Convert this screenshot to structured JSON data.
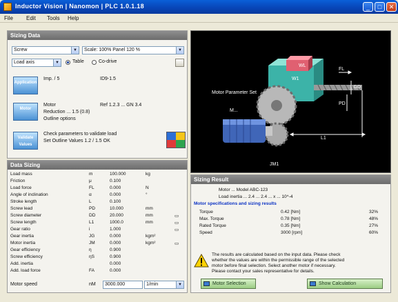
{
  "window": {
    "title": "Inductor Vision | Nanomon            | PLC 1.0.1.18",
    "minimize": "_",
    "maximize": "□",
    "close": "✕"
  },
  "menu": [
    "File",
    "Edit",
    "Tools",
    "Help"
  ],
  "sizing_data": {
    "header": "Sizing Data",
    "combo_1": "Screw",
    "combo_2": "Scale: 100% Panel 120 %",
    "combo_3": "Load axis",
    "radio_1": "Table",
    "radio_2": "Co-drive",
    "rows": [
      {
        "button": "Application",
        "text_a": "Imp. / 5",
        "text_b": "ID9-1.5"
      },
      {
        "button": "Motor",
        "text_a": "Motor",
        "text_b": "Ref 1.2.3 ... GN 3.4",
        "text_c": "Reduction ... 1.5 (0.8)",
        "text_d": "Outline options"
      },
      {
        "button": "Validate Values",
        "text_a": "Check parameters to validate load",
        "text_b": "Set Outline Values 1.2 / 1.5 OK"
      }
    ]
  },
  "diagram": {
    "labels": {
      "wl": "WL",
      "w1": "W1",
      "fl": "FL",
      "dd": "DD",
      "pd": "PD",
      "motor": "Motor Parameter Set",
      "m": "M...",
      "l": "L1",
      "j": "JM1"
    }
  },
  "data_sizing": {
    "header": "Data Sizing",
    "rows": [
      {
        "label": "Load mass",
        "sym": "m",
        "val": "100.000",
        "unit": "kg",
        "unit2": ""
      },
      {
        "label": "Friction",
        "sym": "μ",
        "val": "0.100",
        "unit": "",
        "unit2": ""
      },
      {
        "label": "Load force",
        "sym": "FL",
        "val": "0.000",
        "unit": "N",
        "unit2": ""
      },
      {
        "label": "Angle of inclination",
        "sym": "α",
        "val": "0.000",
        "unit": "°",
        "unit2": ""
      },
      {
        "label": "Stroke length",
        "sym": "L",
        "val": "0.100",
        "unit": "",
        "unit2": ""
      },
      {
        "label": "Screw lead",
        "sym": "PD",
        "val": "10.000",
        "unit": "mm",
        "unit2": ""
      },
      {
        "label": "Screw diameter",
        "sym": "DD",
        "val": "20.000",
        "unit": "mm",
        "unit2": "▭"
      },
      {
        "label": "Screw length",
        "sym": "L1",
        "val": "1000.0",
        "unit": "mm",
        "unit2": "▭"
      },
      {
        "label": "Gear ratio",
        "sym": "i",
        "val": "1.000",
        "unit": "",
        "unit2": "▭"
      },
      {
        "label": "Gear inertia",
        "sym": "JG",
        "val": "0.000",
        "unit": "kgm²",
        "unit2": ""
      },
      {
        "label": "Motor inertia",
        "sym": "JM",
        "val": "0.000",
        "unit": "kgm²",
        "unit2": "▭"
      },
      {
        "label": "Gear efficiency",
        "sym": "η",
        "val": "0.900",
        "unit": "",
        "unit2": ""
      },
      {
        "label": "Screw efficiency",
        "sym": "ηS",
        "val": "0.900",
        "unit": "",
        "unit2": ""
      },
      {
        "label": "Add. inertia",
        "sym": "",
        "val": "0.000",
        "unit": "",
        "unit2": ""
      },
      {
        "label": "Add. load force",
        "sym": "FA",
        "val": "0.000",
        "unit": "",
        "unit2": ""
      }
    ],
    "footer_label": "Motor speed",
    "footer_sym": "nM",
    "footer_value": "3000.000",
    "footer_unit": "1/min"
  },
  "sizing_result": {
    "header": "Sizing Result",
    "line_1": "Motor ... Model ABC-123",
    "line_2": "Load inertia ... 2.4 ... 2.4 ... x ... 10^-4",
    "link": "Motor specifications and sizing results",
    "table": [
      {
        "name": "Torque",
        "value": "0.42 [Nm]",
        "pct": "32%"
      },
      {
        "name": "Max. Torque",
        "value": "0.78 [Nm]",
        "pct": "48%"
      },
      {
        "name": "Rated Torque",
        "value": "0.35 [Nm]",
        "pct": "27%"
      },
      {
        "name": "Speed",
        "value": "3000 [rpm]",
        "pct": "60%"
      }
    ],
    "warning": [
      "The results are calculated based on the input data. Please check",
      "whether the values are within the permissible range of the selected",
      "motor before final selection. Select another motor if necessary.",
      "Please contact your sales representative for details."
    ],
    "btn_left": "Motor Selection",
    "btn_right": "Show Calculation"
  }
}
